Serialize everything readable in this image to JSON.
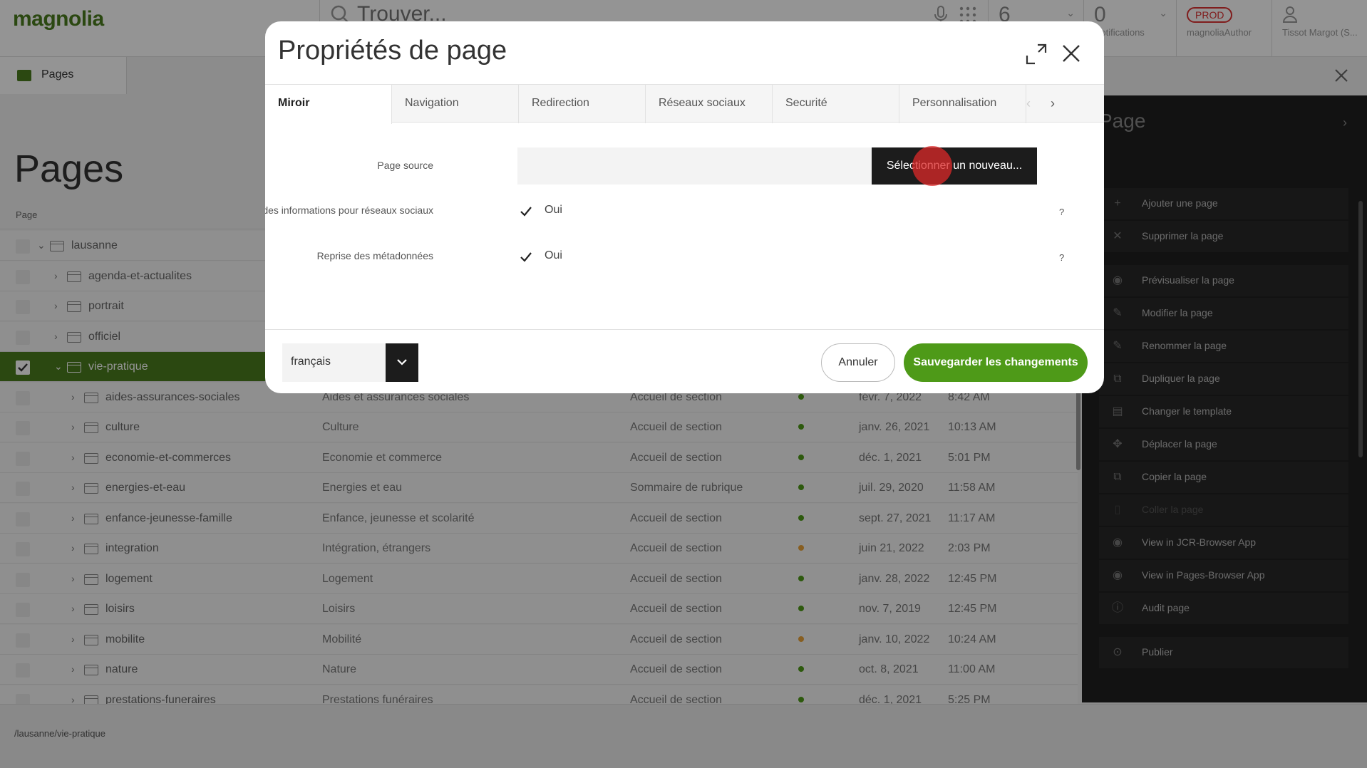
{
  "topbar": {
    "logo": "magnolia",
    "search_placeholder": "Trouver...",
    "tasks_count": "6",
    "notifications_count": "0",
    "notifications_label": "Notifications",
    "env_badge": "PROD",
    "env_instance": "magnoliaAuthor",
    "user_name": "Tissot Margot (S..."
  },
  "app": {
    "tab_label": "Pages",
    "page_title": "Pages",
    "column_page": "Page",
    "footer_path": "/lausanne/vie-pratique"
  },
  "tree": [
    {
      "name": "lausanne",
      "title": "",
      "template": "",
      "status": "",
      "date": "",
      "time": ""
    },
    {
      "name": "agenda-et-actualites",
      "title": "",
      "template": "",
      "status": "",
      "date": "",
      "time": ""
    },
    {
      "name": "portrait",
      "title": "",
      "template": "",
      "status": "",
      "date": "",
      "time": ""
    },
    {
      "name": "officiel",
      "title": "",
      "template": "",
      "status": "",
      "date": "",
      "time": ""
    },
    {
      "name": "vie-pratique",
      "title": "",
      "template": "",
      "status": "",
      "date": "",
      "time": ""
    },
    {
      "name": "aides-assurances-sociales",
      "title": "Aides et assurances sociales",
      "template": "Accueil de section",
      "status": "#4e9a18",
      "date": "févr. 7, 2022",
      "time": "8:42 AM"
    },
    {
      "name": "culture",
      "title": "Culture",
      "template": "Accueil de section",
      "status": "#4e9a18",
      "date": "janv. 26, 2021",
      "time": "10:13 AM"
    },
    {
      "name": "economie-et-commerces",
      "title": "Economie et commerce",
      "template": "Accueil de section",
      "status": "#4e9a18",
      "date": "déc. 1, 2021",
      "time": "5:01 PM"
    },
    {
      "name": "energies-et-eau",
      "title": "Energies et eau",
      "template": "Sommaire de rubrique",
      "status": "#4e9a18",
      "date": "juil. 29, 2020",
      "time": "11:58 AM"
    },
    {
      "name": "enfance-jeunesse-famille",
      "title": "Enfance, jeunesse et scolarité",
      "template": "Accueil de section",
      "status": "#4e9a18",
      "date": "sept. 27, 2021",
      "time": "11:17 AM"
    },
    {
      "name": "integration",
      "title": "Intégration, étrangers",
      "template": "Accueil de section",
      "status": "#e8a33a",
      "date": "juin 21, 2022",
      "time": "2:03 PM"
    },
    {
      "name": "logement",
      "title": "Logement",
      "template": "Accueil de section",
      "status": "#4e9a18",
      "date": "janv. 28, 2022",
      "time": "12:45 PM"
    },
    {
      "name": "loisirs",
      "title": "Loisirs",
      "template": "Accueil de section",
      "status": "#4e9a18",
      "date": "nov. 7, 2019",
      "time": "12:45 PM"
    },
    {
      "name": "mobilite",
      "title": "Mobilité",
      "template": "Accueil de section",
      "status": "#e8a33a",
      "date": "janv. 10, 2022",
      "time": "10:24 AM"
    },
    {
      "name": "nature",
      "title": "Nature",
      "template": "Accueil de section",
      "status": "#4e9a18",
      "date": "oct. 8, 2021",
      "time": "11:00 AM"
    },
    {
      "name": "prestations-funeraires",
      "title": "Prestations funéraires",
      "template": "Accueil de section",
      "status": "#4e9a18",
      "date": "déc. 1, 2021",
      "time": "5:25 PM"
    }
  ],
  "actions": {
    "title": "Page",
    "items": [
      {
        "label": "Ajouter une page",
        "icon": "+",
        "disabled": false
      },
      {
        "label": "Supprimer la page",
        "icon": "✕",
        "disabled": false
      },
      {
        "label": "Prévisualiser la page",
        "icon": "◉",
        "disabled": false
      },
      {
        "label": "Modifier la page",
        "icon": "✎",
        "disabled": false
      },
      {
        "label": "Renommer la page",
        "icon": "✎",
        "disabled": false
      },
      {
        "label": "Dupliquer la page",
        "icon": "⧉",
        "disabled": false
      },
      {
        "label": "Changer le template",
        "icon": "▤",
        "disabled": false
      },
      {
        "label": "Déplacer la page",
        "icon": "✥",
        "disabled": false
      },
      {
        "label": "Copier la page",
        "icon": "⧉",
        "disabled": false
      },
      {
        "label": "Coller la page",
        "icon": "▯",
        "disabled": true
      },
      {
        "label": "View in JCR-Browser App",
        "icon": "◉",
        "disabled": false
      },
      {
        "label": "View in Pages-Browser App",
        "icon": "◉",
        "disabled": false
      },
      {
        "label": "Audit page",
        "icon": "ⓘ",
        "disabled": false
      },
      {
        "label": "Publier",
        "icon": "⊙",
        "disabled": false
      }
    ]
  },
  "dialog": {
    "title": "Propriétés de page",
    "tabs": [
      "Miroir",
      "Navigation",
      "Redirection",
      "Réseaux sociaux",
      "Securité",
      "Personnalisation"
    ],
    "active_tab": "Miroir",
    "field_source_label": "Page source",
    "field_source_value": "",
    "select_button": "Sélectionner un nouveau...",
    "social_label": "Reprise des informations pour réseaux sociaux",
    "social_value": "Oui",
    "meta_label": "Reprise des métadonnées",
    "meta_value": "Oui",
    "help": "?",
    "language": "français",
    "cancel": "Annuler",
    "save": "Sauvegarder les changements"
  }
}
